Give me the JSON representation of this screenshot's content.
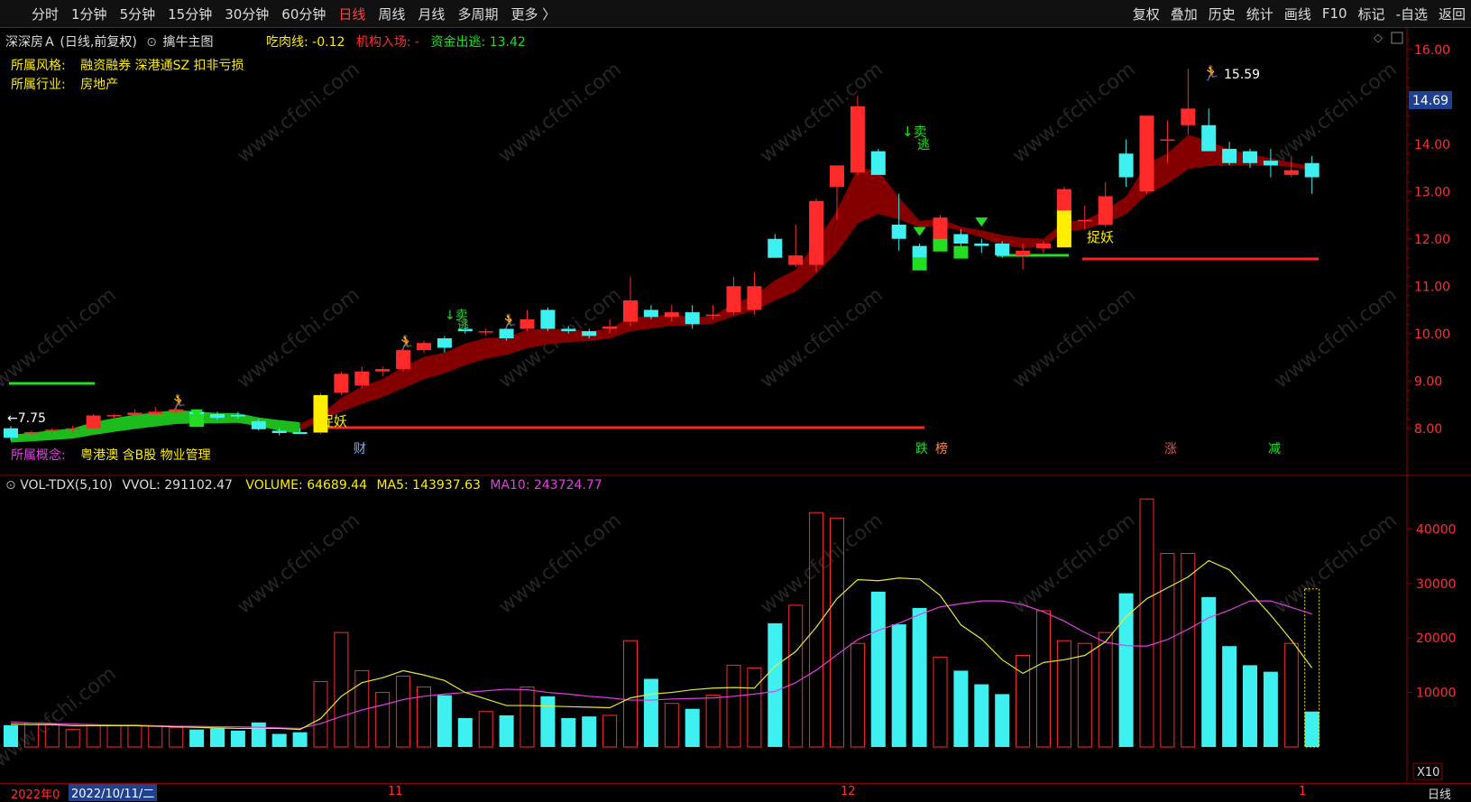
{
  "toolbar": {
    "periods": [
      "分时",
      "1分钟",
      "5分钟",
      "15分钟",
      "30分钟",
      "60分钟",
      "日线",
      "周线",
      "月线",
      "多周期",
      "更多 〉"
    ],
    "active_period": "日线",
    "tools": [
      "复权",
      "叠加",
      "历史",
      "统计",
      "画线",
      "F10",
      "标记",
      "-自选",
      "返回"
    ]
  },
  "header": {
    "stock_title": "深深房Ａ (日线,前复权)",
    "template": "擒牛主图",
    "eat_label": "吃肉线:",
    "eat_value": "-0.12",
    "inst_label": "机构入场:",
    "inst_value": "-",
    "escape_label": "资金出逃:",
    "escape_value": "13.42"
  },
  "info": {
    "style_label": "所属风格:",
    "style_value": "融资融券 深港通SZ 扣非亏损",
    "industry_label": "所属行业:",
    "industry_value": "房地产",
    "concept_label": "所属概念:",
    "concept_value": "粤港澳 含B股 物业管理"
  },
  "volume_header": {
    "name": "VOL-TDX(5,10)",
    "vvol": "VVOL: 291102.47",
    "volume": "VOLUME: 64689.44",
    "ma5": "MA5: 143937.63",
    "ma10": "MA10: 243724.77"
  },
  "price_label": "14.69",
  "x10_label": "X10",
  "bottom": {
    "year_label": "2022年0",
    "date_label": "2022/10/11/二",
    "month_11": "11",
    "month_12": "12",
    "month_1": "1",
    "period_label": "日线"
  },
  "annotations": {
    "low": "←7.75",
    "high": "15.59",
    "zhuoyao": "捉妖",
    "sell": "↓卖",
    "escape": "逃",
    "events": [
      "财",
      "跌",
      "榜",
      "涨",
      "减"
    ]
  },
  "colors": {
    "up": "#ff2a2a",
    "down": "#3ff0f0",
    "ribbon": "#8b0000",
    "ma5": "#e8e832",
    "ma10": "#e040e0",
    "signal_green": "#22dd22",
    "signal_yellow": "#ffee00"
  },
  "chart_data": {
    "type": "candlestick",
    "price_axis": {
      "ylim": [
        7.5,
        16.3
      ],
      "ticks": [
        8,
        9,
        10,
        11,
        12,
        13,
        14,
        15,
        16
      ]
    },
    "volume_axis": {
      "ylim": [
        0,
        48500
      ],
      "ticks": [
        10000,
        20000,
        30000,
        40000
      ]
    },
    "candles": [
      {
        "o": 8.0,
        "h": 8.05,
        "l": 7.75,
        "c": 7.8,
        "v": 4000
      },
      {
        "o": 7.9,
        "h": 7.95,
        "l": 7.85,
        "c": 7.92,
        "v": 4400
      },
      {
        "o": 7.95,
        "h": 8.0,
        "l": 7.9,
        "c": 7.97,
        "v": 4200
      },
      {
        "o": 7.98,
        "h": 8.05,
        "l": 7.9,
        "c": 8.0,
        "v": 3200
      },
      {
        "o": 8.0,
        "h": 8.3,
        "l": 7.98,
        "c": 8.27,
        "v": 4000
      },
      {
        "o": 8.27,
        "h": 8.3,
        "l": 8.22,
        "c": 8.28,
        "v": 4000
      },
      {
        "o": 8.28,
        "h": 8.4,
        "l": 8.25,
        "c": 8.33,
        "v": 4000
      },
      {
        "o": 8.3,
        "h": 8.45,
        "l": 8.28,
        "c": 8.35,
        "v": 3800
      },
      {
        "o": 8.35,
        "h": 8.45,
        "l": 8.3,
        "c": 8.4,
        "v": 3600
      },
      {
        "o": 8.35,
        "h": 8.4,
        "l": 8.2,
        "c": 8.25,
        "v": 3200
      },
      {
        "o": 8.3,
        "h": 8.35,
        "l": 8.18,
        "c": 8.22,
        "v": 3400
      },
      {
        "o": 8.28,
        "h": 8.35,
        "l": 8.2,
        "c": 8.25,
        "v": 3000
      },
      {
        "o": 8.15,
        "h": 8.2,
        "l": 7.95,
        "c": 7.98,
        "v": 4500
      },
      {
        "o": 7.95,
        "h": 8.0,
        "l": 7.85,
        "c": 7.9,
        "v": 2400
      },
      {
        "o": 7.92,
        "h": 8.0,
        "l": 7.88,
        "c": 7.88,
        "v": 2700
      },
      {
        "o": 7.9,
        "h": 8.75,
        "l": 7.88,
        "c": 8.68,
        "v": 12000
      },
      {
        "o": 8.75,
        "h": 9.2,
        "l": 8.7,
        "c": 9.15,
        "v": 21000
      },
      {
        "o": 8.9,
        "h": 9.3,
        "l": 8.85,
        "c": 9.2,
        "v": 14000
      },
      {
        "o": 9.2,
        "h": 9.3,
        "l": 9.1,
        "c": 9.25,
        "v": 10000
      },
      {
        "o": 9.25,
        "h": 9.7,
        "l": 9.2,
        "c": 9.65,
        "v": 13000
      },
      {
        "o": 9.65,
        "h": 9.85,
        "l": 9.6,
        "c": 9.8,
        "v": 11000
      },
      {
        "o": 9.9,
        "h": 9.95,
        "l": 9.6,
        "c": 9.7,
        "v": 9500
      },
      {
        "o": 10.1,
        "h": 10.3,
        "l": 10.0,
        "c": 10.05,
        "v": 5300
      },
      {
        "o": 10.05,
        "h": 10.1,
        "l": 9.95,
        "c": 10.05,
        "v": 6500
      },
      {
        "o": 10.1,
        "h": 10.15,
        "l": 9.85,
        "c": 9.9,
        "v": 5800
      },
      {
        "o": 10.1,
        "h": 10.5,
        "l": 10.05,
        "c": 10.3,
        "v": 11000
      },
      {
        "o": 10.5,
        "h": 10.55,
        "l": 10.05,
        "c": 10.1,
        "v": 9300
      },
      {
        "o": 10.1,
        "h": 10.15,
        "l": 10.0,
        "c": 10.05,
        "v": 5300
      },
      {
        "o": 10.05,
        "h": 10.1,
        "l": 9.9,
        "c": 9.95,
        "v": 5600
      },
      {
        "o": 10.1,
        "h": 10.3,
        "l": 10.0,
        "c": 10.15,
        "v": 5800
      },
      {
        "o": 10.25,
        "h": 11.2,
        "l": 10.15,
        "c": 10.7,
        "v": 19500
      },
      {
        "o": 10.5,
        "h": 10.6,
        "l": 10.3,
        "c": 10.35,
        "v": 12500
      },
      {
        "o": 10.35,
        "h": 10.6,
        "l": 10.25,
        "c": 10.45,
        "v": 8000
      },
      {
        "o": 10.45,
        "h": 10.6,
        "l": 10.1,
        "c": 10.2,
        "v": 7000
      },
      {
        "o": 10.4,
        "h": 10.6,
        "l": 10.3,
        "c": 10.4,
        "v": 9500
      },
      {
        "o": 10.45,
        "h": 11.2,
        "l": 10.4,
        "c": 11.0,
        "v": 15000
      },
      {
        "o": 10.5,
        "h": 11.3,
        "l": 10.4,
        "c": 11.0,
        "v": 14500
      },
      {
        "o": 12.0,
        "h": 12.1,
        "l": 11.6,
        "c": 11.6,
        "v": 22700
      },
      {
        "o": 11.45,
        "h": 12.3,
        "l": 11.4,
        "c": 11.65,
        "v": 26000
      },
      {
        "o": 11.45,
        "h": 12.85,
        "l": 11.3,
        "c": 12.8,
        "v": 43000
      },
      {
        "o": 13.1,
        "h": 13.4,
        "l": 12.4,
        "c": 13.55,
        "v": 42000
      },
      {
        "o": 13.4,
        "h": 15.02,
        "l": 13.35,
        "c": 14.8,
        "v": 19000
      },
      {
        "o": 13.85,
        "h": 13.9,
        "l": 13.35,
        "c": 13.35,
        "v": 28500
      },
      {
        "o": 12.3,
        "h": 12.95,
        "l": 11.75,
        "c": 12.0,
        "v": 22500
      },
      {
        "o": 11.85,
        "h": 11.9,
        "l": 11.6,
        "c": 11.6,
        "v": 25500
      },
      {
        "o": 11.85,
        "h": 12.5,
        "l": 11.8,
        "c": 12.45,
        "v": 16500
      },
      {
        "o": 12.1,
        "h": 12.2,
        "l": 11.85,
        "c": 11.9,
        "v": 14000
      },
      {
        "o": 11.9,
        "h": 12.0,
        "l": 11.7,
        "c": 11.85,
        "v": 11500
      },
      {
        "o": 11.9,
        "h": 11.95,
        "l": 11.6,
        "c": 11.65,
        "v": 9700
      },
      {
        "o": 11.65,
        "h": 11.9,
        "l": 11.35,
        "c": 11.75,
        "v": 16800
      },
      {
        "o": 11.8,
        "h": 11.95,
        "l": 11.7,
        "c": 11.9,
        "v": 25000
      },
      {
        "o": 12.05,
        "h": 13.1,
        "l": 12.0,
        "c": 13.05,
        "v": 19500
      },
      {
        "o": 12.4,
        "h": 12.7,
        "l": 12.2,
        "c": 12.4,
        "v": 19000
      },
      {
        "o": 12.3,
        "h": 13.2,
        "l": 12.25,
        "c": 12.9,
        "v": 21000
      },
      {
        "o": 13.8,
        "h": 14.1,
        "l": 13.1,
        "c": 13.3,
        "v": 28200
      },
      {
        "o": 13.0,
        "h": 14.6,
        "l": 12.95,
        "c": 14.6,
        "v": 45500
      },
      {
        "o": 14.1,
        "h": 14.5,
        "l": 13.6,
        "c": 14.1,
        "v": 35500
      },
      {
        "o": 14.4,
        "h": 15.59,
        "l": 14.2,
        "c": 14.75,
        "v": 35500
      },
      {
        "o": 14.4,
        "h": 14.75,
        "l": 13.9,
        "c": 13.85,
        "v": 27500
      },
      {
        "o": 13.9,
        "h": 14.05,
        "l": 13.55,
        "c": 13.6,
        "v": 18500
      },
      {
        "o": 13.85,
        "h": 13.9,
        "l": 13.5,
        "c": 13.6,
        "v": 15000
      },
      {
        "o": 13.65,
        "h": 13.9,
        "l": 13.3,
        "c": 13.55,
        "v": 13800
      },
      {
        "o": 13.35,
        "h": 13.75,
        "l": 13.3,
        "c": 13.45,
        "v": 19000
      },
      {
        "o": 13.6,
        "h": 13.75,
        "l": 12.95,
        "c": 13.3,
        "v": 6500
      }
    ],
    "ma5": [
      4200,
      4100,
      4100,
      3900,
      3900,
      3900,
      3900,
      3800,
      3700,
      3600,
      3500,
      3400,
      3400,
      3400,
      3200,
      5200,
      9300,
      11800,
      12700,
      14000,
      13200,
      12200,
      10000,
      8800,
      7600,
      7600,
      7500,
      7400,
      7300,
      7200,
      9000,
      9700,
      10000,
      10500,
      10800,
      10900,
      10800,
      14800,
      17500,
      22000,
      27200,
      30700,
      30500,
      31000,
      30800,
      27800,
      22400,
      19800,
      16000,
      13500,
      15500,
      16000,
      16800,
      19300,
      23900,
      27200,
      29200,
      31200,
      34200,
      32500,
      28400,
      24200,
      19600,
      14500
    ],
    "ma10": [
      4600,
      4400,
      4300,
      4200,
      4100,
      4000,
      4000,
      3900,
      3800,
      3800,
      3700,
      3700,
      3600,
      3500,
      3400,
      4300,
      5600,
      6800,
      7700,
      8700,
      9300,
      9700,
      10000,
      10300,
      10600,
      10500,
      10000,
      9700,
      9300,
      9000,
      8600,
      8600,
      8800,
      8900,
      9000,
      9300,
      9700,
      10200,
      11800,
      14100,
      16900,
      19700,
      21400,
      22700,
      24300,
      25700,
      26300,
      26800,
      26800,
      26100,
      24800,
      23100,
      21000,
      19200,
      18600,
      18500,
      19700,
      21600,
      23700,
      25100,
      26800,
      26800,
      25600,
      24400
    ]
  }
}
